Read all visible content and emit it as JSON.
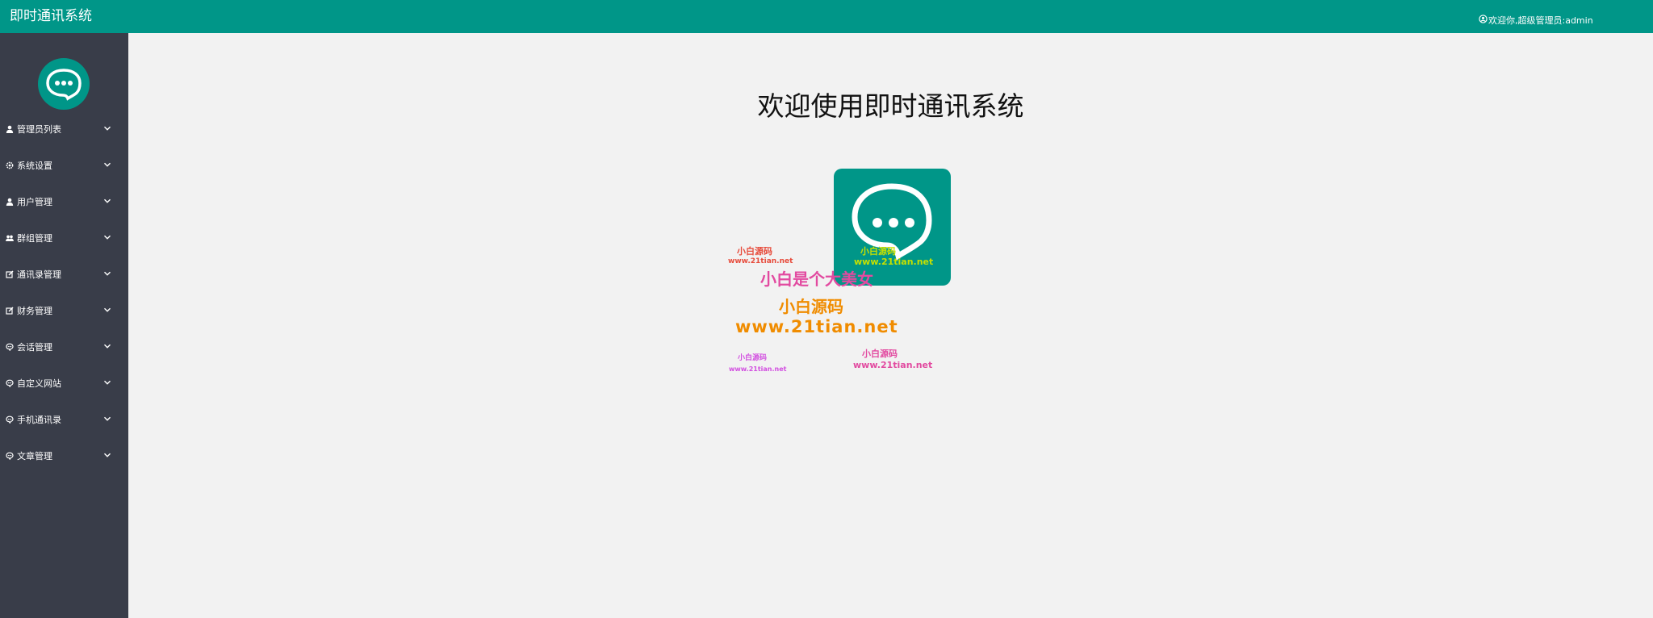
{
  "header": {
    "app_title": "即时通讯系统",
    "user_greeting": "欢迎你,超级管理员:admin",
    "user_icon": "user-circle-icon"
  },
  "sidebar": {
    "logo_icon": "chat-bubble-icon",
    "items": [
      {
        "label": "管理员列表",
        "icon": "user-icon"
      },
      {
        "label": "系统设置",
        "icon": "gear-icon"
      },
      {
        "label": "用户管理",
        "icon": "user-icon"
      },
      {
        "label": "群组管理",
        "icon": "users-icon"
      },
      {
        "label": "通讯录管理",
        "icon": "edit-icon"
      },
      {
        "label": "财务管理",
        "icon": "edit-icon"
      },
      {
        "label": "会话管理",
        "icon": "chat-icon"
      },
      {
        "label": "自定义网站",
        "icon": "chat-icon"
      },
      {
        "label": "手机通讯录",
        "icon": "chat-icon"
      },
      {
        "label": "文章管理",
        "icon": "chat-icon"
      }
    ]
  },
  "main": {
    "title": "欢迎使用即时通讯系统",
    "logo_icon": "chat-bubble-icon"
  },
  "watermarks": {
    "red_small_1": "小白源码",
    "red_small_2": "www.21tian.net",
    "green_1": "小白源码",
    "green_2": "www.21tian.net",
    "pink_large": "小白是个大美女",
    "orange_1": "小白源码",
    "orange_2": "www.21tian.net",
    "magenta_small_1": "小白源码",
    "magenta_small_2": "www.21tian.net",
    "pink_small_1": "小白源码",
    "pink_small_2": "www.21tian.net"
  },
  "colors": {
    "header_bg": "#009688",
    "sidebar_bg": "#393d49",
    "content_bg": "#f2f2f2"
  }
}
